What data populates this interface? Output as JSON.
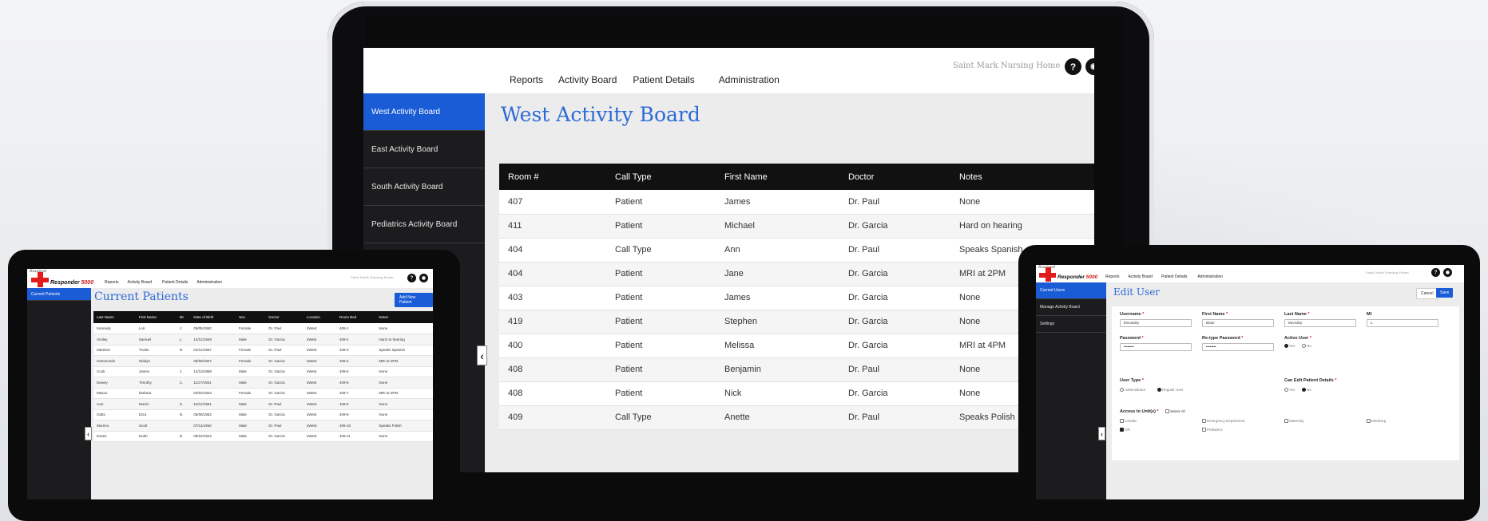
{
  "brand": {
    "rauland": "Rauland",
    "name": "Responder",
    "number": "5000"
  },
  "nav": {
    "reports": "Reports",
    "activity_board": "Activity Board",
    "patient_details": "Patient Details",
    "administration": "Administration"
  },
  "facility": "Saint Mark Nursing Home",
  "icons": {
    "help": "help-icon",
    "user": "user-icon",
    "collapse": "chevron-left-icon"
  },
  "help_glyph": "?",
  "user_glyph": "◉",
  "chevron_glyph": "‹",
  "laptop": {
    "sidebar": [
      "West Activity Board",
      "East Activity Board",
      "South Activity Board",
      "Pediatrics Activity Board"
    ],
    "title": "West Activity Board",
    "columns": [
      "Room #",
      "Call Type",
      "First Name",
      "Doctor",
      "Notes"
    ],
    "rows": [
      [
        "407",
        "Patient",
        "James",
        "Dr. Paul",
        "None"
      ],
      [
        "411",
        "Patient",
        "Michael",
        "Dr. Garcia",
        "Hard on hearing"
      ],
      [
        "404",
        "Call Type",
        "Ann",
        "Dr. Paul",
        "Speaks Spanish"
      ],
      [
        "404",
        "Patient",
        "Jane",
        "Dr. Garcia",
        "MRI at 2PM"
      ],
      [
        "403",
        "Patient",
        "James",
        "Dr. Garcia",
        "None"
      ],
      [
        "419",
        "Patient",
        "Stephen",
        "Dr. Garcia",
        "None"
      ],
      [
        "400",
        "Patient",
        "Melissa",
        "Dr. Garcia",
        "MRI at 4PM"
      ],
      [
        "408",
        "Patient",
        "Benjamin",
        "Dr. Paul",
        "None"
      ],
      [
        "408",
        "Patient",
        "Nick",
        "Dr. Garcia",
        "None"
      ],
      [
        "409",
        "Call Type",
        "Anette",
        "Dr. Paul",
        "Speaks Polish"
      ]
    ]
  },
  "tablet_left": {
    "sidebar": [
      "Current Patients"
    ],
    "title": "Current Patients",
    "add_button": "Add New Patient",
    "columns": [
      "Last Name",
      "First Name",
      "MI",
      "Date of Birth",
      "Sex",
      "Doctor",
      "Location",
      "Room Bed",
      "Notes"
    ],
    "rows": [
      [
        "Kennedy",
        "Lori",
        "J.",
        "09/05/1950",
        "Female",
        "Dr. Paul",
        "4West",
        "409-1",
        "None"
      ],
      [
        "Smiley",
        "Samuel",
        "L.",
        "12/12/1949",
        "Male",
        "Dr. Garcia",
        "4West",
        "409-2",
        "Hard on hearing"
      ],
      [
        "Martinez",
        "Trudie",
        "N.",
        "04/12/1957",
        "Female",
        "Dr. Paul",
        "4West",
        "409-3",
        "Speaks Spanish"
      ],
      [
        "Hammonds",
        "Gladys",
        "",
        "06/09/1947",
        "Female",
        "Dr. Garcia",
        "4West",
        "409-4",
        "MRI at 2PM"
      ],
      [
        "Cook",
        "James",
        "J.",
        "12/13/1958",
        "Male",
        "Dr. Garcia",
        "4West",
        "409-5",
        "None"
      ],
      [
        "Dewey",
        "Timothy",
        "C.",
        "11/27/1951",
        "Male",
        "Dr. Garcia",
        "4West",
        "409-6",
        "None"
      ],
      [
        "Mason",
        "barbara",
        "",
        "02/02/1944",
        "Female",
        "Dr. Garcia",
        "4West",
        "409-7",
        "MRI at 4PM"
      ],
      [
        "Carr",
        "Morris",
        "S.",
        "10/12/1961",
        "Male",
        "Dr. Paul",
        "4West",
        "409-8",
        "None"
      ],
      [
        "Gatto",
        "Ezra",
        "N.",
        "06/06/1952",
        "Male",
        "Dr. Garcia",
        "4West",
        "409-9",
        "None"
      ],
      [
        "Moreno",
        "Scott",
        "",
        "07/11/1950",
        "Male",
        "Dr. Paul",
        "4West",
        "409-10",
        "Speaks Polish"
      ],
      [
        "Evans",
        "Noah",
        "D.",
        "09/22/1942",
        "Male",
        "Dr. Garcia",
        "4West",
        "409-11",
        "None"
      ]
    ]
  },
  "tablet_right": {
    "sidebar": [
      "Current Users",
      "Manage Activity Board",
      "Settings"
    ],
    "title": "Edit User",
    "cancel": "Cancel",
    "save": "Save",
    "form": {
      "username_label": "Username",
      "username": "bmcauley",
      "first_label": "First Name",
      "first": "Brian",
      "last_label": "Last Name",
      "last": "McAuley",
      "mi_label": "MI",
      "mi": "L",
      "password_label": "Password",
      "password": "••••••••",
      "repassword_label": "Re-type Password",
      "repassword": "••••••••",
      "active_label": "Active User",
      "yes": "Yes",
      "no": "No",
      "usertype_label": "User Type",
      "admin": "Administrator",
      "regular": "Regular User",
      "canedit_label": "Can Edit Patient Details",
      "access_label": "Access to Unit(s)",
      "select_all": "Select All",
      "units": [
        "Cardiac",
        "Emergency Department",
        "Maternity",
        "MedSurg",
        "OR",
        "Pediatrics"
      ]
    },
    "required_mark": "*"
  }
}
